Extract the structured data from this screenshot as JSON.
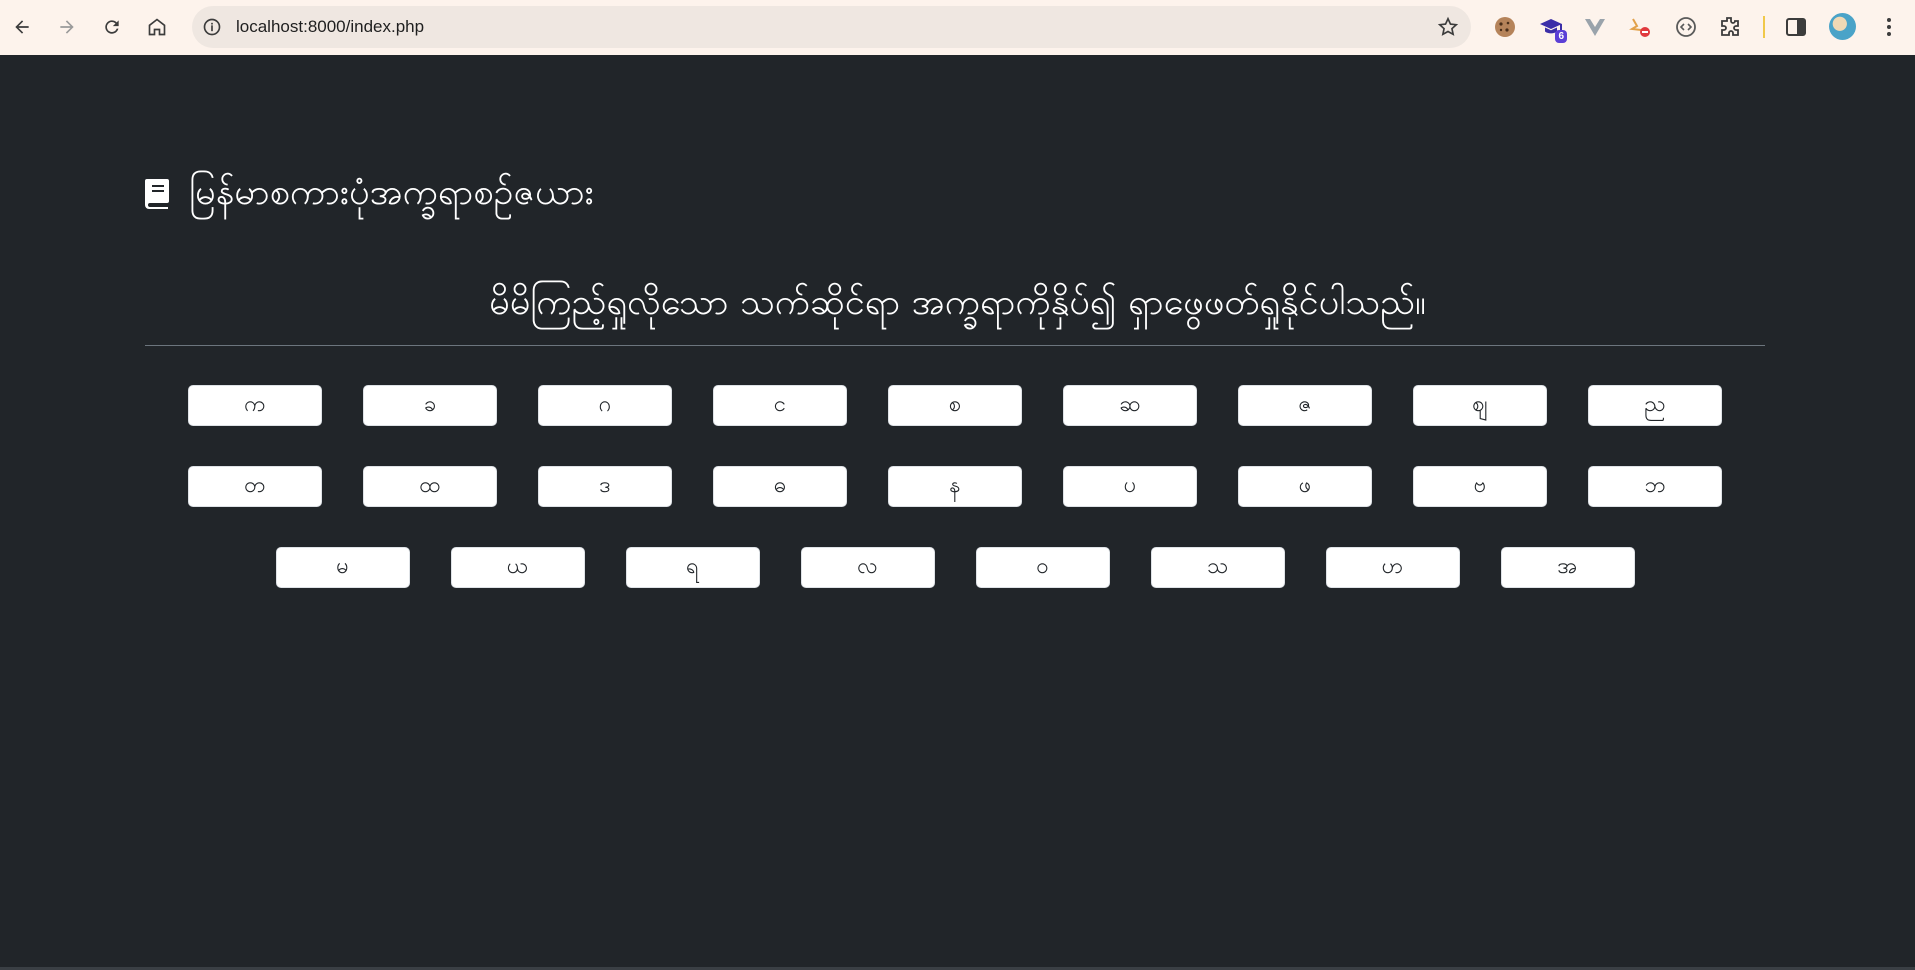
{
  "browser": {
    "url": "localhost:8000/index.php",
    "extension_badge": "6"
  },
  "page": {
    "brand_title": "မြန်မာစကားပုံအက္ခရာစဉ်ဇယား",
    "subtitle": "မိမိကြည့်ရှုလိုသော သက်ဆိုင်ရာ အက္ခရာကိုနှိပ်၍ ရှာဖွေဖတ်ရှုနိုင်ပါသည်။"
  },
  "keyboard": {
    "rows": [
      [
        "က",
        "ခ",
        "ဂ",
        "င",
        "စ",
        "ဆ",
        "ဇ",
        "ဈ",
        "ည"
      ],
      [
        "တ",
        "ထ",
        "ဒ",
        "ဓ",
        "န",
        "ပ",
        "ဖ",
        "ဗ",
        "ဘ"
      ],
      [
        "မ",
        "ယ",
        "ရ",
        "လ",
        "ဝ",
        "သ",
        "ဟ",
        "အ"
      ]
    ]
  },
  "colors": {
    "page_background": "#212529",
    "toolbar_background": "#fdf3ec",
    "button_background": "#ffffff"
  },
  "icons": {
    "back": "arrow-left-icon",
    "forward": "arrow-right-icon",
    "reload": "reload-icon",
    "home": "home-icon",
    "site_info": "info-icon",
    "bookmark": "star-icon",
    "brand": "book-icon"
  }
}
